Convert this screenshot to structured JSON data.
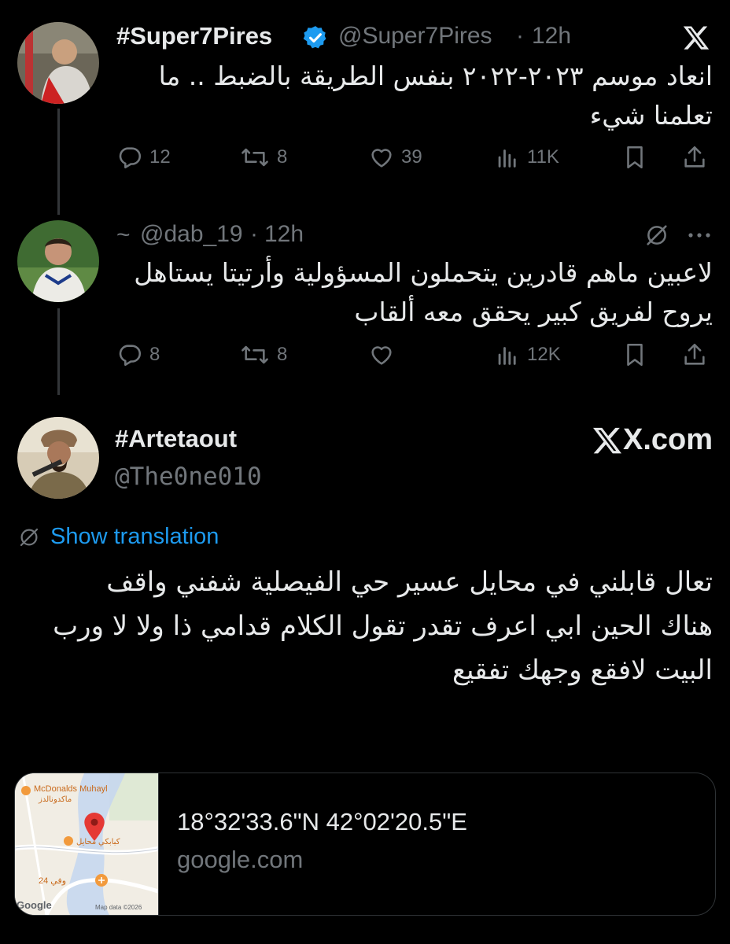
{
  "tweet1": {
    "name": "#Super7Pires",
    "handle": "@Super7Pires",
    "time": "12h",
    "separator": "·",
    "text_line1": "انعاد موسم ٢٠٢٣-٢٠٢٢ بنفس الطريقة بالضبط .. ما",
    "text_line2": "تعلمنا شيء",
    "replies": "12",
    "reposts": "8",
    "likes": "39",
    "views": "11K"
  },
  "tweet2": {
    "name": "~",
    "handle": "@dab_19",
    "time": "12h",
    "separator": "·",
    "text_line1": "لاعبين ماهم قادرين يتحملون المسؤولية وأرتيتا يستاهل",
    "text_line2": "يروح لفريق كبير يحقق معه ألقاب",
    "replies": "8",
    "reposts": "8",
    "likes": "",
    "views": "12K"
  },
  "tweet3": {
    "name": "#Artetaout",
    "handle": "@The0ne010",
    "site_logo": "X.com",
    "show_translation": "Show translation",
    "text_line1": "تعال قابلني في محايل عسير حي الفيصلية شفني واقف",
    "text_line2": "هناك الحين ابي اعرف تقدر تقول الكلام قدامي ذا ولا لا ورب",
    "text_line3": "البيت لافقع وجهك تفقيع"
  },
  "link_card": {
    "title": "18°32'33.6\"N 42°02'20.5\"E",
    "domain": "google.com",
    "map": {
      "place1": "McDonalds Muhayl",
      "place1_ar": "ماكدونالدز",
      "place2": "كبابكي محايل",
      "place3": "وفي 24",
      "attribution": "Map data ©2026",
      "google": "Google"
    }
  },
  "colors": {
    "background": "#000000",
    "text": "#e7e9ea",
    "secondary": "#71767b",
    "link": "#1d9bf0",
    "verified": "#1d9bf0",
    "map_pin": "#e53935"
  },
  "icons": [
    "x-logo-icon",
    "verified-icon",
    "reply-icon",
    "repost-icon",
    "like-icon",
    "views-icon",
    "bookmark-icon",
    "share-icon",
    "no-translate-icon",
    "more-icon",
    "map-pin-icon"
  ]
}
